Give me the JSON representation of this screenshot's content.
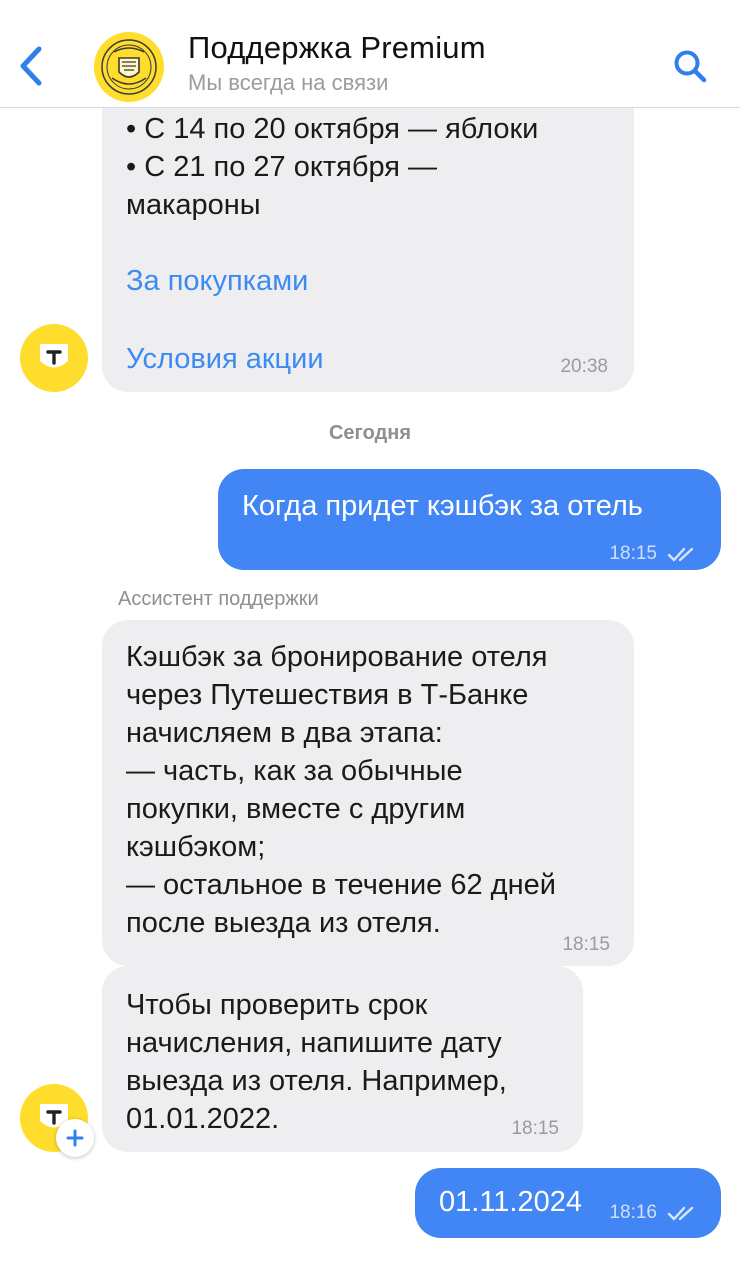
{
  "header": {
    "title": "Поддержка Premium",
    "subtitle": "Мы всегда на связи",
    "back_icon": "chevron-left-icon",
    "search_icon": "search-icon",
    "accent_color": "#2f80ed"
  },
  "chat": {
    "promo_message": {
      "lines": "• С 14 по 20 октября — яблоки\n• С 21 по 27 октября —\nмакароны",
      "link_shopping": "За покупками",
      "link_terms": "Условия акции",
      "time": "20:38"
    },
    "date_separator": "Сегодня",
    "user_message_1": {
      "text": "Когда придет кэшбэк за отель",
      "time": "18:15",
      "status_icon": "double-check-icon"
    },
    "assistant_label": "Ассистент поддержки",
    "assistant_message_1": {
      "text": "Кэшбэк за бронирование отеля\nчерез Путешествия в Т-Банке\nначисляем в два этапа:\n— часть, как за обычные\nпокупки, вместе с другим\nкэшбэком;\n— остальное в течение 62 дней\nпосле выезда из отеля.",
      "time": "18:15"
    },
    "assistant_message_2": {
      "text": "Чтобы проверить срок\nначисления, напишите дату\nвыезда из отеля. Например,\n01.01.2022.",
      "time": "18:15"
    },
    "user_message_2": {
      "text": "01.11.2024",
      "time": "18:16",
      "status_icon": "double-check-icon"
    }
  },
  "colors": {
    "outgoing_bubble": "#4285f4",
    "incoming_bubble": "#eeeef0",
    "brand_yellow": "#ffdd2d"
  }
}
